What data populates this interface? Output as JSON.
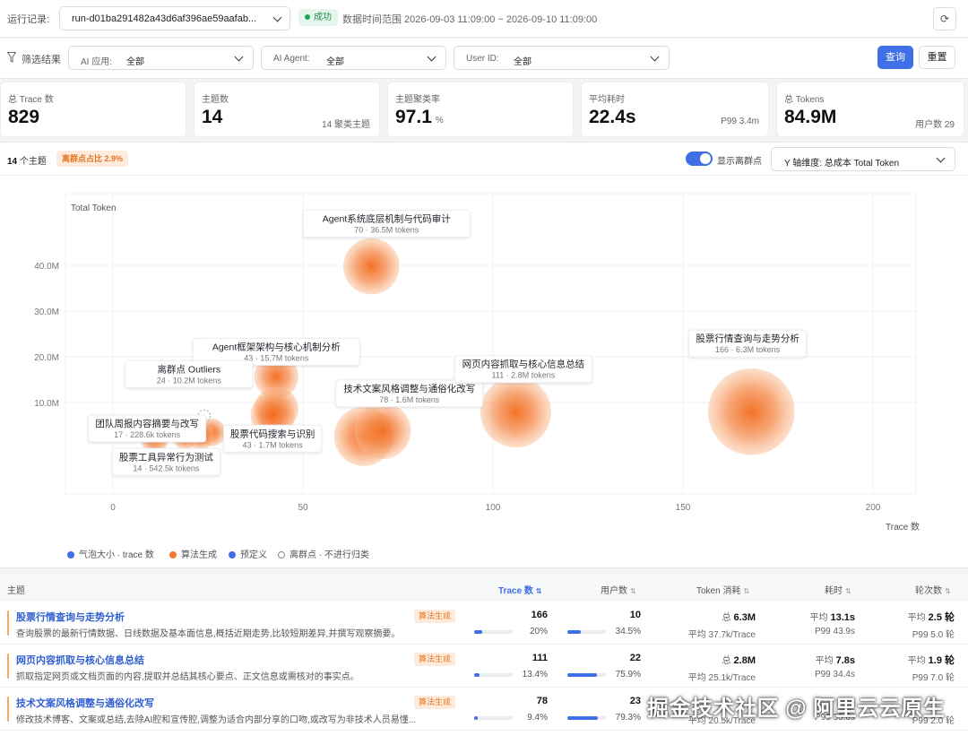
{
  "topbar": {
    "run_label": "运行记录:",
    "run_id": "run-d01ba291482a43d6af396ae59aafab...",
    "status": "成功",
    "time_range": "数据时间范围 2026-09-03 11:09:00 ~ 2026-09-10 11:09:00"
  },
  "filters": {
    "label": "筛选结果",
    "ai_app_label": "AI 应用:",
    "ai_app_value": "全部",
    "ai_agent_label": "AI Agent:",
    "ai_agent_value": "全部",
    "user_id_label": "User ID:",
    "user_id_value": "全部",
    "query_button": "查询",
    "reset_button": "重置"
  },
  "stats": [
    {
      "label": "总 Trace 数",
      "value": "829",
      "unit": "",
      "sub": ""
    },
    {
      "label": "主题数",
      "value": "14",
      "unit": "",
      "sub": "14 聚类主题"
    },
    {
      "label": "主题聚类率",
      "value": "97.1",
      "unit": "%",
      "sub": ""
    },
    {
      "label": "平均耗时",
      "value": "22.4s",
      "unit": "",
      "sub": "P99 3.4m"
    },
    {
      "label": "总 Tokens",
      "value": "84.9M",
      "unit": "",
      "sub": "用户数 29"
    }
  ],
  "chart_header": {
    "topic_count": "14",
    "topic_count_suffix": "个主题",
    "outlier_ratio": "离群点占比 2.9%",
    "show_outliers_label": "显示离群点",
    "show_outliers": true,
    "y_axis_select": "Y 轴维度: 总成本 Total Token"
  },
  "chart_data": {
    "type": "scatter",
    "ylabel": "Total Token",
    "xlabel": "Trace 数",
    "x_ticks": [
      "0",
      "50",
      "100",
      "150",
      "200"
    ],
    "y_ticks": [
      "10.0M",
      "20.0M",
      "30.0M",
      "40.0M"
    ],
    "xlim": [
      0,
      212
    ],
    "ylim": [
      -3,
      53
    ],
    "legend": [
      {
        "label": "气泡大小 · trace 数",
        "color": "#3f6fe6",
        "style": "filled"
      },
      {
        "label": "算法生成",
        "color": "#f07a2e",
        "style": "filled"
      },
      {
        "label": "预定义",
        "color": "#3f6fe6",
        "style": "filled"
      },
      {
        "label": "离群点 · 不进行归类",
        "color": "#888888",
        "style": "hollow"
      }
    ],
    "points": [
      {
        "x": 68,
        "y": 39.8,
        "size": 70,
        "kind": "algo"
      },
      {
        "x": 43,
        "y": 15.7,
        "size": 43,
        "kind": "algo"
      },
      {
        "x": 43,
        "y": 8.6,
        "size": 43,
        "kind": "algo"
      },
      {
        "x": 42,
        "y": 7.2,
        "size": 43,
        "kind": "algo"
      },
      {
        "x": 24,
        "y": 7.0,
        "size": 24,
        "kind": "outlier"
      },
      {
        "x": 66,
        "y": 2.6,
        "size": 78,
        "kind": "algo"
      },
      {
        "x": 71,
        "y": 3.8,
        "size": 70,
        "kind": "algo"
      },
      {
        "x": 106,
        "y": 7.9,
        "size": 111,
        "kind": "algo"
      },
      {
        "x": 168,
        "y": 8.0,
        "size": 166,
        "kind": "algo"
      },
      {
        "x": 26,
        "y": 3.5,
        "size": 17,
        "kind": "algo"
      },
      {
        "x": 11,
        "y": 2.0,
        "size": 17,
        "kind": "algo"
      },
      {
        "x": 12,
        "y": 3.3,
        "size": 14,
        "kind": "algo"
      },
      {
        "x": 19,
        "y": 2.5,
        "size": 14,
        "kind": "algo"
      },
      {
        "x": 23,
        "y": 2.7,
        "size": 17,
        "kind": "algo"
      }
    ],
    "annotations": [
      {
        "title": "Agent系统底层机制与代码审计",
        "sub": "70 · 36.5M tokens",
        "x": 72,
        "y": 49.5
      },
      {
        "title": "Agent框架架构与核心机制分析",
        "sub": "43 · 15.7M tokens",
        "x": 43,
        "y": 21.5
      },
      {
        "title": "离群点 Outliers",
        "sub": "24 · 10.2M tokens",
        "x": 20,
        "y": 16.6
      },
      {
        "title": "技术文案风格调整与通俗化改写",
        "sub": "78 · 1.6M tokens",
        "x": 78,
        "y": 12.4
      },
      {
        "title": "网页内容抓取与核心信息总结",
        "sub": "111 · 2.8M tokens",
        "x": 108,
        "y": 17.7
      },
      {
        "title": "股票行情查询与走势分析",
        "sub": "166 · 6.3M tokens",
        "x": 167,
        "y": 23.3
      },
      {
        "title": "团队周报内容摘要与改写",
        "sub": "17 · 228.6k tokens",
        "x": 9,
        "y": 4.7
      },
      {
        "title": "股票代码搜索与识别",
        "sub": "43 · 1.7M tokens",
        "x": 42,
        "y": 2.5
      },
      {
        "title": "股票工具异常行为测试",
        "sub": "14 · 542.5k tokens",
        "x": 14,
        "y": -2.6
      }
    ]
  },
  "table": {
    "headers": {
      "topic": "主题",
      "trace": "Trace 数",
      "users": "用户数",
      "tokens": "Token 消耗",
      "latency": "耗时",
      "turns": "轮次数"
    },
    "sort_icon": "⇅",
    "rows": [
      {
        "name": "股票行情查询与走势分析",
        "desc": "查询股票的最新行情数据、日线数据及基本面信息,概括近期走势,比较短期差异,并撰写观察摘要。",
        "tag": "算法生成",
        "trace": "166",
        "trace_pct": "20%",
        "trace_fill": 0.2,
        "users": "10",
        "users_pct": "34.5%",
        "users_fill": 0.345,
        "tok_prefix": "总",
        "tokens": "6.3M",
        "tok_avg": "平均 37.7k/Trace",
        "lat_prefix": "平均",
        "latency": "13.1s",
        "lat_p99": "P99 43.9s",
        "turn_prefix": "平均",
        "turns": "2.5 轮",
        "turn_p99": "P99 5.0 轮"
      },
      {
        "name": "网页内容抓取与核心信息总结",
        "desc": "抓取指定网页或文档页面的内容,提取并总结其核心要点、正文信息或需核对的事实点。",
        "tag": "算法生成",
        "trace": "111",
        "trace_pct": "13.4%",
        "trace_fill": 0.134,
        "users": "22",
        "users_pct": "75.9%",
        "users_fill": 0.759,
        "tok_prefix": "总",
        "tokens": "2.8M",
        "tok_avg": "平均 25.1k/Trace",
        "lat_prefix": "平均",
        "latency": "7.8s",
        "lat_p99": "P99 34.4s",
        "turn_prefix": "平均",
        "turns": "1.9 轮",
        "turn_p99": "P99 7.0 轮"
      },
      {
        "name": "技术文案风格调整与通俗化改写",
        "desc": "修改技术博客、文案或总结,去除AI腔和宣传腔,调整为适合内部分享的口吻,或改写为非技术人员易懂...",
        "tag": "算法生成",
        "trace": "78",
        "trace_pct": "9.4%",
        "trace_fill": 0.094,
        "users": "23",
        "users_pct": "79.3%",
        "users_fill": 0.793,
        "tok_prefix": "总",
        "tokens": "",
        "tok_avg": "平均 20.5k/Trace",
        "lat_prefix": "平均",
        "latency": "",
        "lat_p99": "P99 35.8s",
        "turn_prefix": "平均",
        "turns": "",
        "turn_p99": "P99 2.0 轮"
      }
    ]
  },
  "watermark": "掘金技术社区 @ 阿里云云原生"
}
